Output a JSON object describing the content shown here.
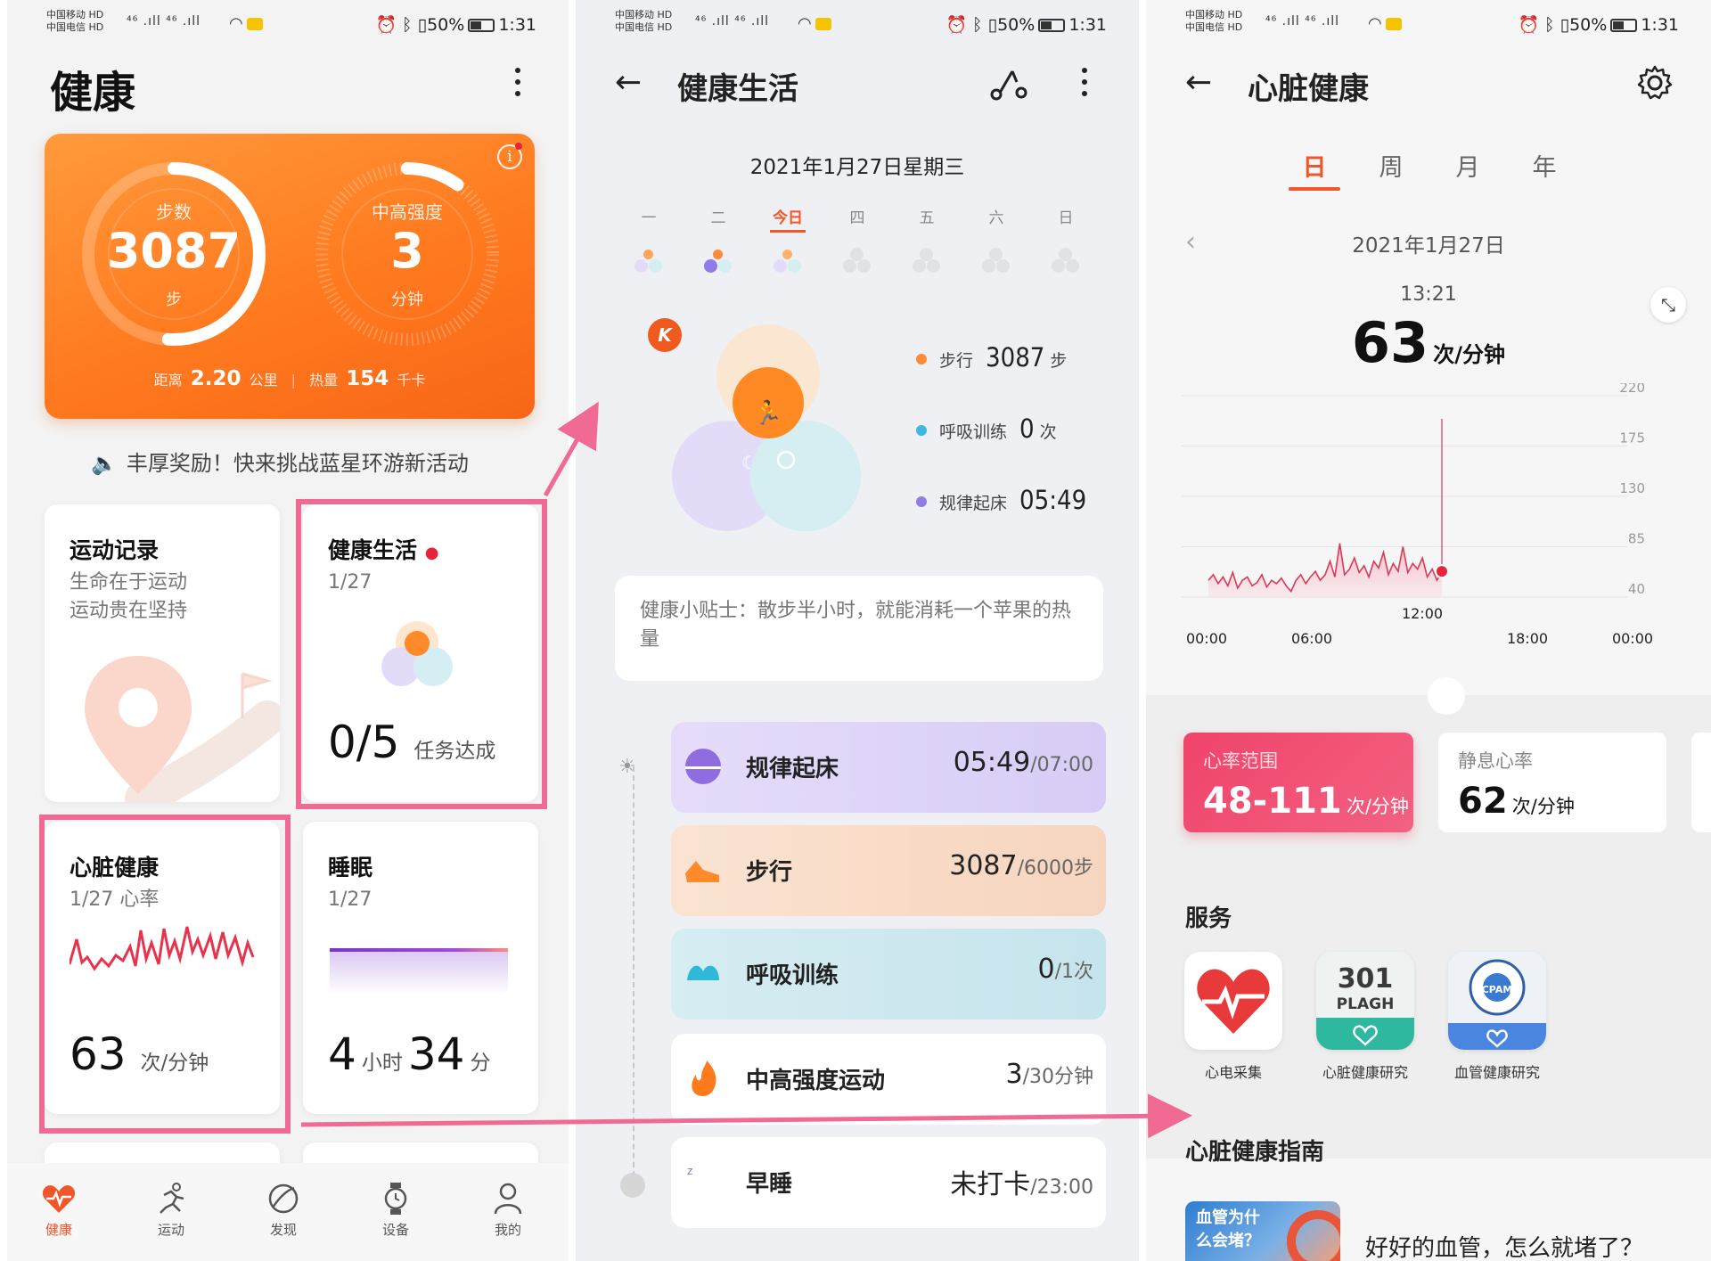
{
  "status_bar": {
    "carrier1": "中国移动",
    "carrier2": "中国电信",
    "hd": "HD",
    "sig_text": "⁴⁶ .ıll ⁴⁶ .ıll",
    "battery": "50%",
    "time": "1:31"
  },
  "panel1": {
    "title": "健康",
    "steps_label": "步数",
    "steps_value": "3087",
    "steps_unit": "步",
    "steps_progress": 0.51,
    "intensity_label": "中高强度",
    "intensity_value": "3",
    "intensity_unit": "分钟",
    "intensity_progress": 0.1,
    "distance_label": "距离",
    "distance_value": "2.20",
    "distance_unit": "公里",
    "calorie_label": "热量",
    "calorie_value": "154",
    "calorie_unit": "千卡",
    "announcement": "丰厚奖励！快来挑战蓝星环游新活动",
    "cards": {
      "exercise": {
        "title": "运动记录",
        "line1": "生命在于运动",
        "line2": "运动贵在坚持"
      },
      "healthy_life": {
        "title": "健康生活",
        "date": "1/27",
        "value": "0/5",
        "unit": "任务达成"
      },
      "heart": {
        "title": "心脏健康",
        "date": "1/27 心率",
        "value": "63",
        "unit": "次/分钟"
      },
      "sleep": {
        "title": "睡眠",
        "date": "1/27",
        "hours": "4",
        "hours_unit": "小时",
        "mins": "34",
        "mins_unit": "分"
      }
    },
    "tabs": [
      {
        "label": "健康",
        "icon": "heart-pulse-icon",
        "active": true
      },
      {
        "label": "运动",
        "icon": "runner-icon",
        "active": false
      },
      {
        "label": "发现",
        "icon": "discover-icon",
        "active": false
      },
      {
        "label": "设备",
        "icon": "watch-icon",
        "active": false
      },
      {
        "label": "我的",
        "icon": "person-icon",
        "active": false
      }
    ],
    "accent": "#f06a94"
  },
  "panel2": {
    "title": "健康生活",
    "date": "2021年1月27日星期三",
    "weekdays": [
      "一",
      "二",
      "今日",
      "四",
      "五",
      "六",
      "日"
    ],
    "legend": [
      {
        "label": "步行",
        "value": "3087",
        "unit": "步",
        "color": "#ff8a3a"
      },
      {
        "label": "呼吸训练",
        "value": "0",
        "unit": "次",
        "color": "#3fb8e0"
      },
      {
        "label": "规律起床",
        "value": "05:49",
        "unit": "",
        "color": "#8f7ce8"
      }
    ],
    "tip": "健康小贴士：散步半小时，就能消耗一个苹果的热量",
    "tasks": [
      {
        "name": "规律起床",
        "value": "05:49",
        "target": "/07:00"
      },
      {
        "name": "步行",
        "value": "3087",
        "target": "/6000步"
      },
      {
        "name": "呼吸训练",
        "value": "0",
        "target": "/1次"
      },
      {
        "name": "中高强度运动",
        "value": "3",
        "target": "/30分钟"
      },
      {
        "name": "早睡",
        "value": "未打卡",
        "target": "/23:00"
      }
    ]
  },
  "panel3": {
    "title": "心脏健康",
    "periods": [
      "日",
      "周",
      "月",
      "年"
    ],
    "active_period": "日",
    "date": "2021年1月27日",
    "time": "13:21",
    "bpm": "63",
    "bpm_unit": "次/分钟",
    "chart_data": {
      "type": "area",
      "y_ticks": [
        "220",
        "175",
        "130",
        "85",
        "40"
      ],
      "x_ticks": [
        "00:00",
        "06:00",
        "12:00",
        "18:00",
        "00:00"
      ],
      "cursor_label": "12:00",
      "ylim": [
        40,
        220
      ],
      "series": [
        {
          "values": [
            55,
            60,
            52,
            58,
            50,
            62,
            48,
            55,
            58,
            50,
            53,
            60,
            49,
            55,
            52,
            57,
            50,
            45,
            55,
            60,
            52,
            58,
            63,
            55,
            60,
            72,
            58,
            88,
            60,
            65,
            75,
            62,
            68,
            58,
            72,
            66,
            80,
            60,
            70,
            63,
            85,
            62,
            70,
            65,
            75,
            58,
            65,
            55,
            63
          ]
        }
      ]
    },
    "range_card": {
      "label": "心率范围",
      "value": "48-111",
      "unit": "次/分钟"
    },
    "resting_card": {
      "label": "静息心率",
      "value": "62",
      "unit": "次/分钟"
    },
    "services_title": "服务",
    "services": [
      {
        "label": "心电采集",
        "icon": "ecg-heart-icon"
      },
      {
        "label": "心脏健康研究",
        "icon": "plagh-logo-icon",
        "logo_text": "301 PLAGH"
      },
      {
        "label": "血管健康研究",
        "icon": "cpam-logo-icon",
        "logo_text": "CPAM"
      }
    ],
    "guide_title": "心脏健康指南",
    "guide_thumb_text": "血管为什么会堵？",
    "guide_article": "好好的血管，怎么就堵了？"
  }
}
